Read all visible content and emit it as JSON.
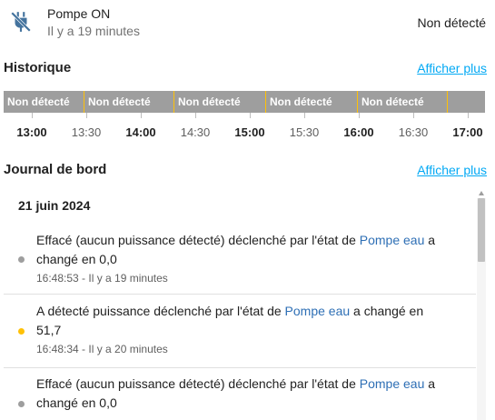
{
  "header": {
    "entity_name": "Pompe ON",
    "relative_time": "Il y a 19 minutes",
    "state": "Non détecté",
    "icon": "power-plug-off-icon"
  },
  "history": {
    "title": "Historique",
    "show_more": "Afficher plus",
    "segments": [
      {
        "label": "Non détecté"
      },
      {
        "label": "Non détecté"
      },
      {
        "label": "Non détecté"
      },
      {
        "label": "Non détecté"
      },
      {
        "label": "Non détecté"
      },
      {
        "label": ""
      }
    ],
    "axis": [
      "13:00",
      "13:30",
      "14:00",
      "14:30",
      "15:00",
      "15:30",
      "16:00",
      "16:30",
      "17:00"
    ]
  },
  "logbook": {
    "title": "Journal de bord",
    "show_more": "Afficher plus",
    "date": "21 juin 2024",
    "entries": [
      {
        "before": "Effacé (aucun puissance détecté) déclenché par l'état de ",
        "link": "Pompe eau",
        "after_line1": " a",
        "line2": "changé en 0,0",
        "meta": "16:48:53 - Il y a 19 minutes",
        "dot_color": "#9e9e9e"
      },
      {
        "before": "A détecté puissance déclenché par l'état de ",
        "link": "Pompe eau",
        "after_line1": " a changé en",
        "line2": "51,7",
        "meta": "16:48:34 - Il y a 20 minutes",
        "dot_color": "#ffc107"
      },
      {
        "before": "Effacé (aucun puissance détecté) déclenché par l'état de ",
        "link": "Pompe eau",
        "after_line1": " a",
        "line2": "changé en 0,0",
        "meta": "",
        "dot_color": "#9e9e9e"
      }
    ]
  },
  "colors": {
    "timeline_off": "#9e9e9e",
    "divider": "#ffc107",
    "link": "#03a9f4",
    "entity_link": "#2e6fb5",
    "icon": "#44739e"
  }
}
